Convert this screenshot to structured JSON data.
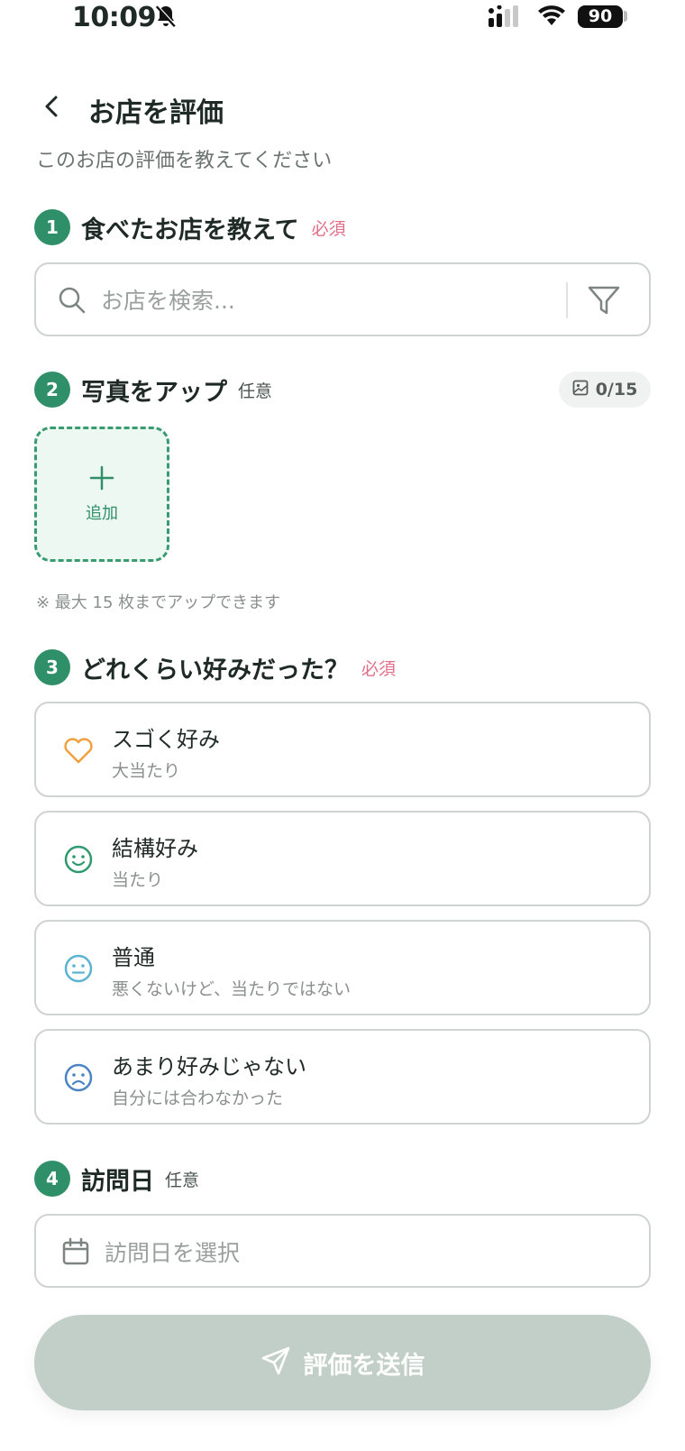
{
  "status_bar": {
    "time": "10:09",
    "battery": "90"
  },
  "header": {
    "title": "お店を評価",
    "subtitle": "このお店の評価を教えてください"
  },
  "sections": {
    "shop": {
      "number": "1",
      "title": "食べたお店を教えて",
      "tag": "必須",
      "search_placeholder": "お店を検索..."
    },
    "photo": {
      "number": "2",
      "title": "写真をアップ",
      "tag": "任意",
      "count": "0/15",
      "add_label": "追加",
      "note": "※ 最大 15 枚までアップできます"
    },
    "rating": {
      "number": "3",
      "title": "どれくらい好みだった？",
      "tag": "必須",
      "options": [
        {
          "label": "スゴく好み",
          "sub": "大当たり",
          "icon": "heart-icon",
          "color": "#f0a040"
        },
        {
          "label": "結構好み",
          "sub": "当たり",
          "icon": "smile-icon",
          "color": "#2f9a6e"
        },
        {
          "label": "普通",
          "sub": "悪くないけど、当たりではない",
          "icon": "neutral-face-icon",
          "color": "#5ab3d0"
        },
        {
          "label": "あまり好みじゃない",
          "sub": "自分には合わなかった",
          "icon": "frown-icon",
          "color": "#4a84c4"
        }
      ]
    },
    "visit_date": {
      "number": "4",
      "title": "訪問日",
      "tag": "任意",
      "placeholder": "訪問日を選択"
    }
  },
  "submit": {
    "label": "評価を送信"
  },
  "colors": {
    "accent": "#2f8f68",
    "required": "#e0708a",
    "submit_disabled": "#c2cfc8"
  }
}
